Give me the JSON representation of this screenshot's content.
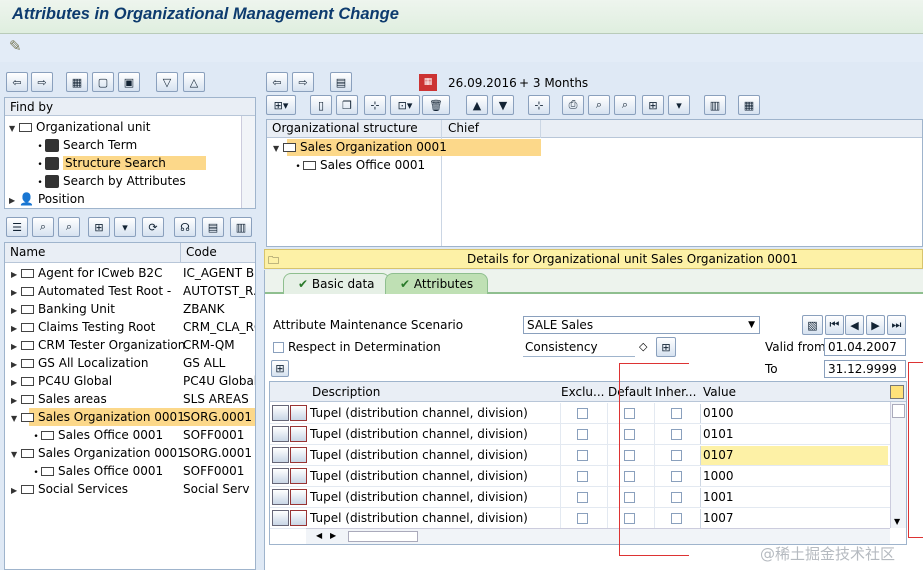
{
  "title": "Attributes in Organizational Management Change",
  "header": {
    "date": "26.09.2016",
    "period": "+ 3 Months"
  },
  "find_by": {
    "heading": "Find by",
    "items": [
      {
        "label": "Organizational unit",
        "level": 0,
        "icon": "folder-icon",
        "expand": "down"
      },
      {
        "label": "Search Term",
        "level": 1,
        "icon": "binoculars-icon"
      },
      {
        "label": "Structure Search",
        "level": 1,
        "icon": "binoculars-icon",
        "selected": true
      },
      {
        "label": "Search by Attributes",
        "level": 1,
        "icon": "binoculars-icon"
      },
      {
        "label": "Position",
        "level": 0,
        "icon": "person-icon",
        "expand": "right"
      }
    ]
  },
  "hitlist": {
    "col_name": "Name",
    "col_code": "Code",
    "rows": [
      {
        "name": "Agent for ICweb B2C",
        "code": "IC_AGENT B2",
        "level": 0,
        "expand": "right"
      },
      {
        "name": "Automated Test Root -",
        "code": "AUTOTST_R.",
        "level": 0,
        "expand": "right"
      },
      {
        "name": "Banking Unit",
        "code": "ZBANK",
        "level": 0,
        "expand": "right"
      },
      {
        "name": "Claims Testing Root",
        "code": "CRM_CLA_RO.",
        "level": 0,
        "expand": "right"
      },
      {
        "name": "CRM Tester Organization",
        "code": "CRM-QM",
        "level": 0,
        "expand": "right"
      },
      {
        "name": "GS All Localization",
        "code": "GS ALL",
        "level": 0,
        "expand": "right"
      },
      {
        "name": "PC4U Global",
        "code": "PC4U Global",
        "level": 0,
        "expand": "right"
      },
      {
        "name": "Sales areas",
        "code": "SLS AREAS",
        "level": 0,
        "expand": "right"
      },
      {
        "name": "Sales Organization 0001",
        "code": "SORG.0001",
        "level": 0,
        "expand": "down",
        "selected": true
      },
      {
        "name": "Sales Office 0001",
        "code": "SOFF0001",
        "level": 1
      },
      {
        "name": "Sales Organization 0001",
        "code": "SORG.0001",
        "level": 0,
        "expand": "down"
      },
      {
        "name": "Sales Office 0001",
        "code": "SOFF0001",
        "level": 1
      },
      {
        "name": "Social Services",
        "code": "Social Serv",
        "level": 0,
        "expand": "right"
      }
    ]
  },
  "structure": {
    "col_org": "Organizational structure",
    "col_chief": "Chief",
    "rows": [
      {
        "label": "Sales Organization 0001",
        "level": 0,
        "selected": true
      },
      {
        "label": "Sales Office 0001",
        "level": 1
      }
    ]
  },
  "details": {
    "title": "Details for Organizational unit Sales Organization 0001",
    "tabs": [
      {
        "label": "Basic data"
      },
      {
        "label": "Attributes",
        "active": true
      }
    ],
    "scenario_label": "Attribute Maintenance Scenario",
    "scenario_value": "SALE Sales",
    "respect_label": "Respect in Determination",
    "consistency_label": "Consistency",
    "valid_from_label": "Valid from",
    "valid_from": "01.04.2007",
    "to_label": "To",
    "to": "31.12.9999",
    "cols": {
      "description": "Description",
      "exclu": "Exclu...",
      "default": "Default",
      "inher": "Inher...",
      "value": "Value"
    },
    "rows": [
      {
        "description": "Tupel (distribution channel, division)",
        "value": "0100"
      },
      {
        "description": "Tupel (distribution channel, division)",
        "value": "0101"
      },
      {
        "description": "Tupel (distribution channel, division)",
        "value": "0107",
        "highlight": true
      },
      {
        "description": "Tupel (distribution channel, division)",
        "value": "1000"
      },
      {
        "description": "Tupel (distribution channel, division)",
        "value": "1001"
      },
      {
        "description": "Tupel (distribution channel, division)",
        "value": "1007"
      }
    ]
  },
  "watermark": "@稀土掘金技术社区",
  "colors": {
    "selection": "#fcd88a",
    "title": "#0d3b6e",
    "annotation": "#d33"
  }
}
